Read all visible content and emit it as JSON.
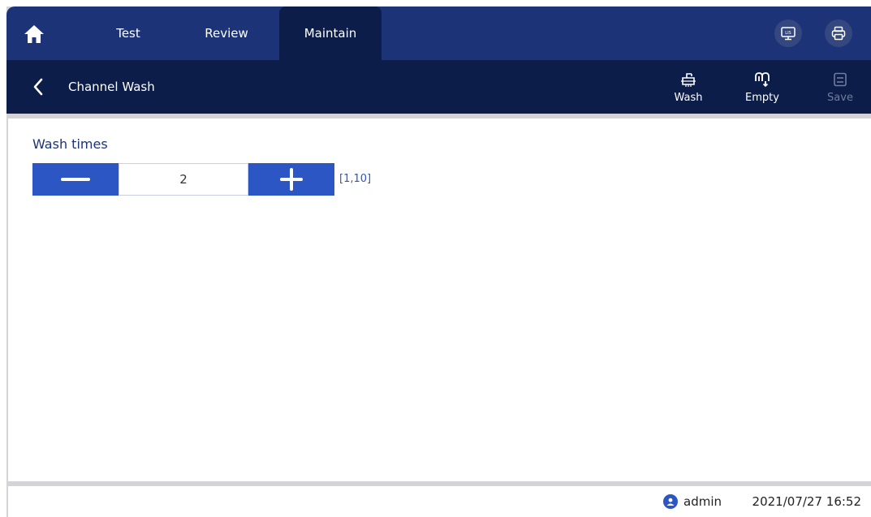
{
  "nav": {
    "home_icon": "home-icon",
    "tabs": [
      {
        "label": "Test"
      },
      {
        "label": "Review"
      },
      {
        "label": "Maintain",
        "active": true
      }
    ],
    "right_icons": [
      "lis-monitor-icon",
      "printer-icon"
    ],
    "lis_text": "LIS"
  },
  "header": {
    "back_icon": "chevron-left-icon",
    "title": "Channel Wash",
    "actions": [
      {
        "label": "Wash",
        "icon": "wash-icon",
        "enabled": true
      },
      {
        "label": "Empty",
        "icon": "empty-icon",
        "enabled": true
      },
      {
        "label": "Save",
        "icon": "save-icon",
        "enabled": false
      }
    ]
  },
  "main": {
    "wash_times_label": "Wash times",
    "wash_times_value": "2",
    "range_text": "[1,10]"
  },
  "footer": {
    "user": "admin",
    "datetime": "2021/07/27 16:52"
  },
  "colors": {
    "nav_bg": "#1d3377",
    "header_bg": "#0d1d4a",
    "accent": "#2c56c4",
    "disabled": "#6f7c9c"
  }
}
